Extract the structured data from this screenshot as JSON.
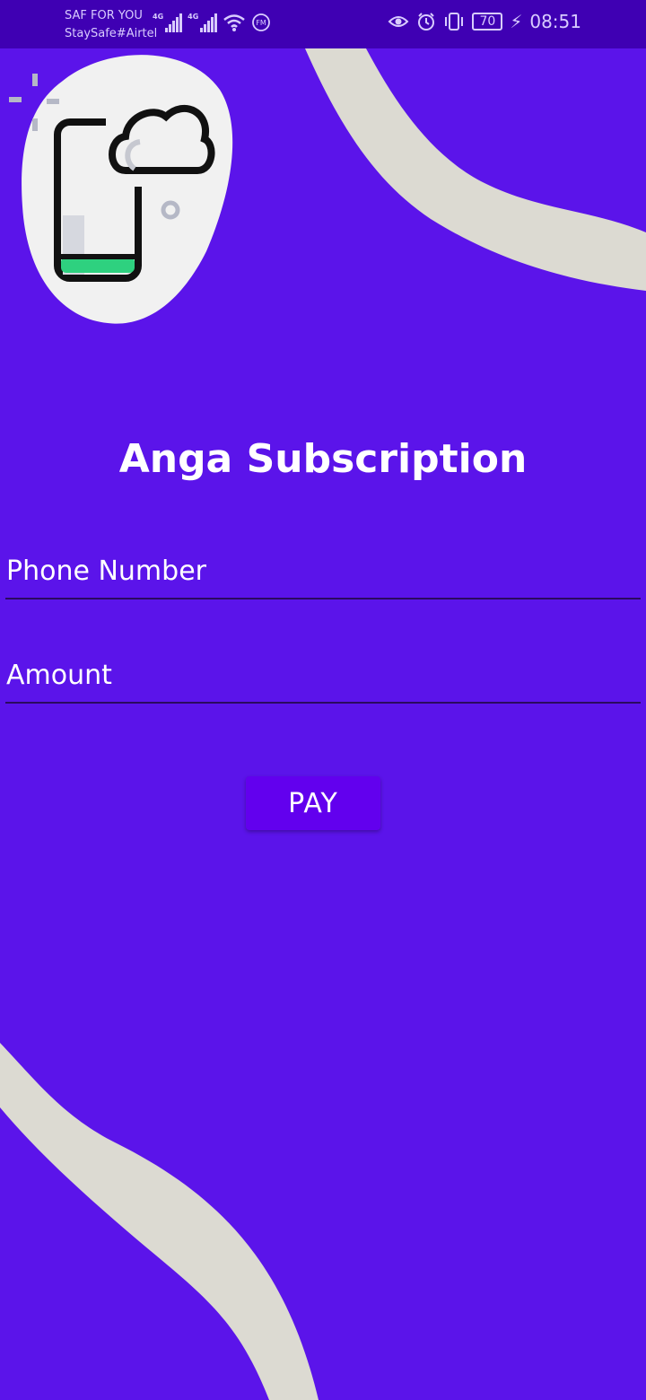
{
  "status_bar": {
    "carrier_primary": "SAF FOR YOU",
    "carrier_secondary": "StaySafe#Airtel",
    "network_tag_1": "4G",
    "network_tag_2": "4G",
    "fm_icon_text": "FM",
    "battery_level": "70",
    "time": "08:51"
  },
  "screen": {
    "title": "Anga Subscription",
    "phone_placeholder": "Phone Number",
    "amount_placeholder": "Amount",
    "pay_label": "PAY"
  },
  "colors": {
    "background": "#5b14ea",
    "status_bar": "#3f00b3",
    "curve": "#dcdad2",
    "button": "#6200ee"
  }
}
